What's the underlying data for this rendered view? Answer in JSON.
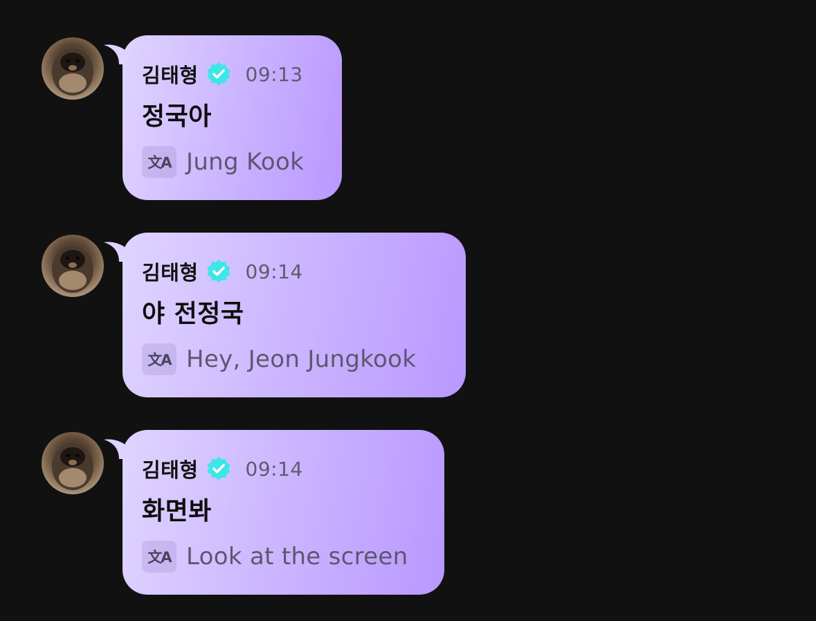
{
  "colors": {
    "background": "#111111",
    "bubble_start": "#dfd4ff",
    "bubble_end": "#b998ff",
    "verified_badge": "#3ee6e6"
  },
  "messages": [
    {
      "sender": "김태형",
      "verified_icon": "verified-badge-icon",
      "time": "09:13",
      "text": "정국아",
      "translate_icon": "translate-icon",
      "translation": "Jung Kook"
    },
    {
      "sender": "김태형",
      "verified_icon": "verified-badge-icon",
      "time": "09:14",
      "text": "야 전정국",
      "translate_icon": "translate-icon",
      "translation": "Hey, Jeon Jungkook"
    },
    {
      "sender": "김태형",
      "verified_icon": "verified-badge-icon",
      "time": "09:14",
      "text": "화면봐",
      "translate_icon": "translate-icon",
      "translation": "Look at the screen"
    }
  ]
}
